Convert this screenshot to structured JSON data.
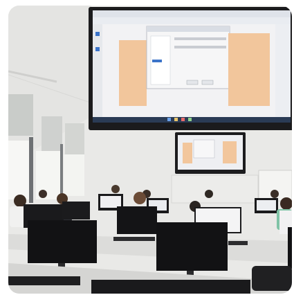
{
  "scene": {
    "subject": "computer-classroom",
    "colors": {
      "wall": "#e9e9e7",
      "ceiling": "#eeeeec",
      "screen_bezel": "#1b1b1d",
      "screen_ui": "#f2f2f4",
      "accent_pane": "#f2c69c",
      "taskbar": "#2a3b55",
      "desk": "#dcdcda",
      "monitor": "#121214"
    }
  }
}
